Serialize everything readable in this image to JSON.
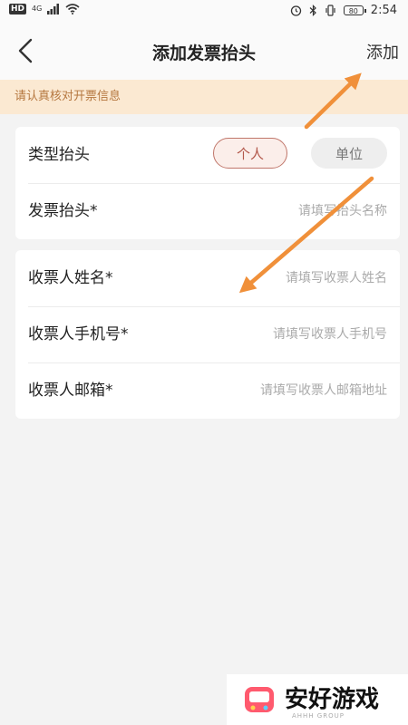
{
  "status_bar": {
    "left_badge": "HD",
    "network": "4G",
    "time": "2:54",
    "battery": "80"
  },
  "nav": {
    "title": "添加发票抬头",
    "action": "添加"
  },
  "notice": "请认真核对开票信息",
  "invoice_card": {
    "type_label": "类型抬头",
    "type_options": [
      "个人",
      "单位"
    ],
    "selected_type": "个人",
    "title_label": "发票抬头*",
    "title_placeholder": "请填写抬头名称"
  },
  "recipient_card": {
    "name_label": "收票人姓名*",
    "name_placeholder": "请填写收票人姓名",
    "phone_label": "收票人手机号*",
    "phone_placeholder": "请填写收票人手机号",
    "email_label": "收票人邮箱*",
    "email_placeholder": "请填写收票人邮箱地址"
  },
  "watermark": {
    "text": "安好游戏",
    "sub": "AHHH GROUP"
  },
  "colors": {
    "accent": "#b3584b",
    "arrow": "#f0903a",
    "notice_bg": "#fbe9d2",
    "notice_text": "#b5773f"
  },
  "icons": [
    "hd-icon",
    "signal-icon",
    "wifi-icon",
    "alarm-icon",
    "bluetooth-icon",
    "vibrate-icon",
    "battery-icon",
    "back-arrow-icon",
    "game-logo-icon"
  ]
}
